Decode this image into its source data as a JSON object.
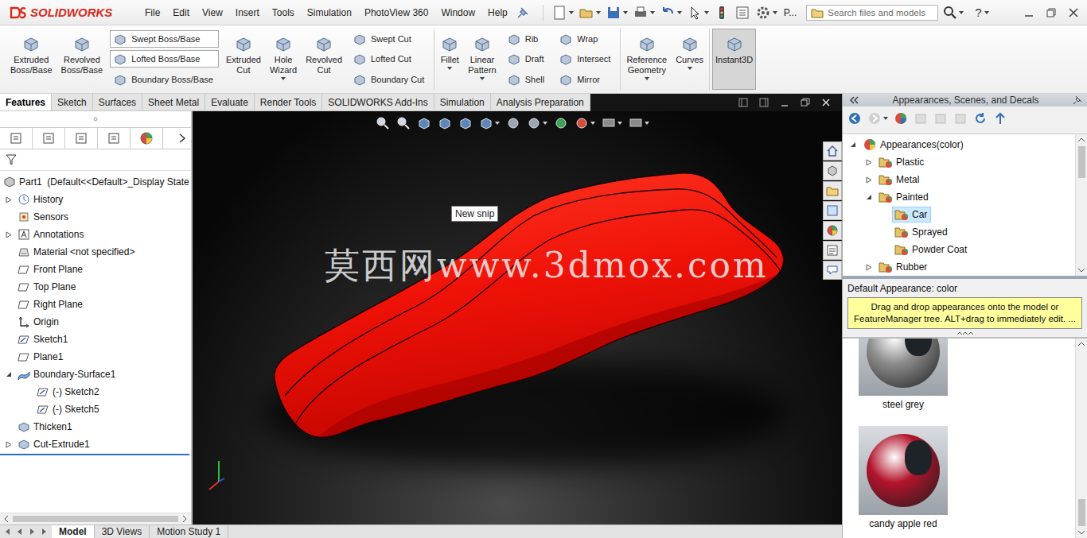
{
  "app": {
    "brand": "SOLIDWORKS"
  },
  "menu": [
    "File",
    "Edit",
    "View",
    "Insert",
    "Tools",
    "Simulation",
    "PhotoView 360",
    "Window",
    "Help"
  ],
  "toolbar": {
    "overflow_label": "P...",
    "search": {
      "placeholder": "Search files and models"
    },
    "help": "?"
  },
  "ribbon": [
    {
      "items": [
        {
          "kind": "large",
          "label": "Extruded Boss/Base",
          "menu": false,
          "selected": false
        },
        {
          "kind": "large",
          "label": "Revolved Boss/Base",
          "menu": false,
          "selected": false
        },
        {
          "kind": "stack",
          "entries": [
            {
              "label": "Swept Boss/Base",
              "outlined": true
            },
            {
              "label": "Lofted Boss/Base",
              "outlined": true
            },
            {
              "label": "Boundary Boss/Base",
              "outlined": false
            }
          ]
        },
        {
          "kind": "large",
          "label": "Extruded Cut",
          "menu": false,
          "selected": false
        },
        {
          "kind": "large",
          "label": "Hole Wizard",
          "menu": true,
          "selected": false
        },
        {
          "kind": "large",
          "label": "Revolved Cut",
          "menu": false,
          "selected": false
        },
        {
          "kind": "stack",
          "entries": [
            {
              "label": "Swept Cut",
              "outlined": false
            },
            {
              "label": "Lofted Cut",
              "outlined": false
            },
            {
              "label": "Boundary Cut",
              "outlined": false
            }
          ]
        }
      ]
    },
    {
      "items": [
        {
          "kind": "large",
          "label": "Fillet",
          "menu": true,
          "selected": false
        },
        {
          "kind": "large",
          "label": "Linear Pattern",
          "menu": true,
          "selected": false
        },
        {
          "kind": "stack",
          "entries": [
            {
              "label": "Rib",
              "outlined": false
            },
            {
              "label": "Draft",
              "outlined": false
            },
            {
              "label": "Shell",
              "outlined": false
            }
          ]
        },
        {
          "kind": "stack",
          "entries": [
            {
              "label": "Wrap",
              "outlined": false
            },
            {
              "label": "Intersect",
              "outlined": false
            },
            {
              "label": "Mirror",
              "outlined": false
            }
          ]
        }
      ]
    },
    {
      "items": [
        {
          "kind": "large",
          "label": "Reference Geometry",
          "menu": true,
          "selected": false
        },
        {
          "kind": "large",
          "label": "Curves",
          "menu": true,
          "selected": false
        }
      ]
    },
    {
      "items": [
        {
          "kind": "large",
          "label": "Instant3D",
          "menu": false,
          "selected": true
        }
      ]
    }
  ],
  "command_tabs": [
    {
      "label": "Features",
      "selected": true
    },
    {
      "label": "Sketch",
      "selected": false
    },
    {
      "label": "Surfaces",
      "selected": false
    },
    {
      "label": "Sheet Metal",
      "selected": false
    },
    {
      "label": "Evaluate",
      "selected": false
    },
    {
      "label": "Render Tools",
      "selected": false
    },
    {
      "label": "SOLIDWORKS Add-Ins",
      "selected": false
    },
    {
      "label": "Simulation",
      "selected": false
    },
    {
      "label": "Analysis Preparation",
      "selected": false
    }
  ],
  "feature_tree": {
    "root": {
      "label": "Part1  (Default<<Default>_Display State"
    },
    "items": [
      {
        "label": "History",
        "kind": "history",
        "depth": 0,
        "expandable": true,
        "expanded": false
      },
      {
        "label": "Sensors",
        "kind": "sensors",
        "depth": 0,
        "expandable": false,
        "expanded": false
      },
      {
        "label": "Annotations",
        "kind": "annotations",
        "depth": 0,
        "expandable": true,
        "expanded": false
      },
      {
        "label": "Material <not specified>",
        "kind": "material",
        "depth": 0,
        "expandable": false,
        "expanded": false
      },
      {
        "label": "Front Plane",
        "kind": "plane",
        "depth": 0,
        "expandable": false,
        "expanded": false
      },
      {
        "label": "Top Plane",
        "kind": "plane",
        "depth": 0,
        "expandable": false,
        "expanded": false
      },
      {
        "label": "Right Plane",
        "kind": "plane",
        "depth": 0,
        "expandable": false,
        "expanded": false
      },
      {
        "label": "Origin",
        "kind": "origin",
        "depth": 0,
        "expandable": false,
        "expanded": false
      },
      {
        "label": "Sketch1",
        "kind": "sketch",
        "depth": 0,
        "expandable": false,
        "expanded": false
      },
      {
        "label": "Plane1",
        "kind": "plane",
        "depth": 0,
        "expandable": false,
        "expanded": false
      },
      {
        "label": "Boundary-Surface1",
        "kind": "surface",
        "depth": 0,
        "expandable": true,
        "expanded": true
      },
      {
        "label": "(-) Sketch2",
        "kind": "sketch",
        "depth": 1,
        "expandable": false,
        "expanded": false
      },
      {
        "label": "(-) Sketch5",
        "kind": "sketch",
        "depth": 1,
        "expandable": false,
        "expanded": false
      },
      {
        "label": "Thicken1",
        "kind": "feature",
        "depth": 0,
        "expandable": false,
        "expanded": false
      },
      {
        "label": "Cut-Extrude1",
        "kind": "feature",
        "depth": 0,
        "expandable": true,
        "expanded": false
      }
    ]
  },
  "bottom_tabs": [
    {
      "label": "Model",
      "selected": true
    },
    {
      "label": "3D Views",
      "selected": false
    },
    {
      "label": "Motion Study 1",
      "selected": false
    }
  ],
  "viewport": {
    "tooltip": "New snip",
    "watermark": "莫西网www.3dmox.com"
  },
  "task_pane": {
    "title": "Appearances, Scenes, and Decals",
    "tree": [
      {
        "label": "Appearances(color)",
        "depth": 0,
        "expandable": true,
        "expanded": true,
        "selected": false
      },
      {
        "label": "Plastic",
        "depth": 1,
        "expandable": true,
        "expanded": false,
        "selected": false
      },
      {
        "label": "Metal",
        "depth": 1,
        "expandable": true,
        "expanded": false,
        "selected": false
      },
      {
        "label": "Painted",
        "depth": 1,
        "expandable": true,
        "expanded": true,
        "selected": false
      },
      {
        "label": "Car",
        "depth": 2,
        "expandable": false,
        "expanded": false,
        "selected": true
      },
      {
        "label": "Sprayed",
        "depth": 2,
        "expandable": false,
        "expanded": false,
        "selected": false
      },
      {
        "label": "Powder Coat",
        "depth": 2,
        "expandable": false,
        "expanded": false,
        "selected": false
      },
      {
        "label": "Rubber",
        "depth": 1,
        "expandable": true,
        "expanded": false,
        "selected": false
      }
    ],
    "default_appearance": "Default Appearance: color",
    "hint": "Drag and drop appearances onto the model or FeatureManager tree.  ALT+drag to immediately edit. ...",
    "swatches": [
      {
        "label": "steel grey",
        "color": "#8c8c8c"
      },
      {
        "label": "candy apple red",
        "color": "#b3142c"
      }
    ]
  }
}
